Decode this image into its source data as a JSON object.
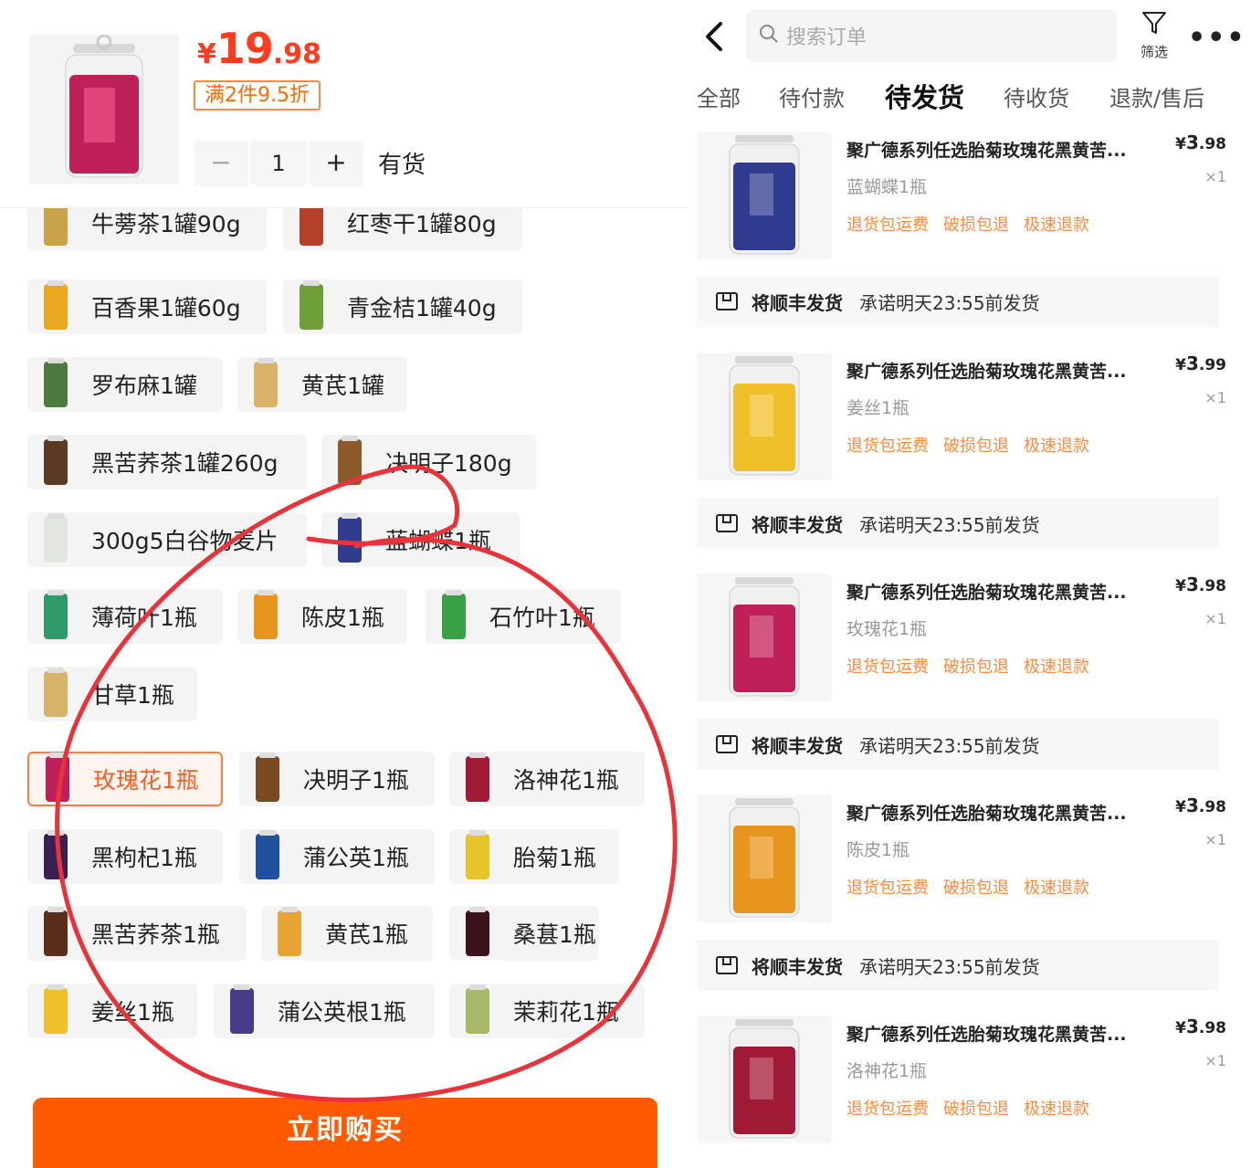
{
  "sku_panel": {
    "price": {
      "currency": "¥",
      "integer": "19",
      "decimal": ".98"
    },
    "promo": "满2件9.5折",
    "quantity": {
      "minus": "−",
      "value": "1",
      "plus": "+"
    },
    "stock": "有货",
    "options": [
      {
        "label": "牛蒡茶1罐90g",
        "color": "#c9a24a"
      },
      {
        "label": "红枣干1罐80g",
        "color": "#b5402a"
      },
      {
        "label": "百香果1罐60g",
        "color": "#e8a821"
      },
      {
        "label": "青金桔1罐40g",
        "color": "#6f9e3a"
      },
      {
        "label": "罗布麻1罐",
        "color": "#4d7a3e"
      },
      {
        "label": "黄芪1罐",
        "color": "#d9b36a"
      },
      {
        "label": "黑苦荞茶1罐260g",
        "color": "#5a3a24"
      },
      {
        "label": "决明子180g",
        "color": "#8a5a2a"
      },
      {
        "label": "300g5白谷物麦片",
        "color": "#e3e6df"
      },
      {
        "label": "蓝蝴蝶1瓶",
        "color": "#2f3c8f"
      },
      {
        "label": "薄荷叶1瓶",
        "color": "#2f9a6a"
      },
      {
        "label": "陈皮1瓶",
        "color": "#e8951d"
      },
      {
        "label": "石竹叶1瓶",
        "color": "#3aa046"
      },
      {
        "label": "甘草1瓶",
        "color": "#d8b46a"
      },
      {
        "label": "玫瑰花1瓶",
        "color": "#c0205a"
      },
      {
        "label": "决明子1瓶",
        "color": "#7a4a24"
      },
      {
        "label": "洛神花1瓶",
        "color": "#a01a36"
      },
      {
        "label": "黑枸杞1瓶",
        "color": "#3a1f52"
      },
      {
        "label": "蒲公英1瓶",
        "color": "#2050a0"
      },
      {
        "label": "胎菊1瓶",
        "color": "#e6c42a"
      },
      {
        "label": "黑苦荞茶1瓶",
        "color": "#5a2e1a"
      },
      {
        "label": "黄芪1瓶",
        "color": "#e8a432"
      },
      {
        "label": "桑葚1瓶",
        "color": "#3a1418"
      },
      {
        "label": "姜丝1瓶",
        "color": "#f0c02a"
      },
      {
        "label": "蒲公英根1瓶",
        "color": "#4a3a8a"
      },
      {
        "label": "茉莉花1瓶",
        "color": "#a8b86a"
      }
    ],
    "selected_option": "玫瑰花1瓶",
    "buy_button": "立即购买",
    "accent_color": "#ff5a00",
    "annotation_color": "#e8333a"
  },
  "orders_panel": {
    "search_placeholder": "搜索订单",
    "filter_label": "筛选",
    "more": "•••",
    "tabs": [
      "全部",
      "待付款",
      "待发货",
      "待收货",
      "退款/售后"
    ],
    "active_tab": "待发货",
    "orders": [
      {
        "title": "聚广德系列任选胎菊玫瑰花黑黄苦...",
        "sku": "蓝蝴蝶1瓶",
        "price_prefix": "¥",
        "price_int": "3",
        "price_dec": ".98",
        "qty": "×1",
        "tags": [
          "退货包运费",
          "破损包退",
          "极速退款"
        ],
        "jar_color": "#2f3c8f"
      },
      {
        "title": "聚广德系列任选胎菊玫瑰花黑黄苦...",
        "sku": "姜丝1瓶",
        "price_prefix": "¥",
        "price_int": "3",
        "price_dec": ".99",
        "qty": "×1",
        "tags": [
          "退货包运费",
          "破损包退",
          "极速退款"
        ],
        "jar_color": "#f0c02a"
      },
      {
        "title": "聚广德系列任选胎菊玫瑰花黑黄苦...",
        "sku": "玫瑰花1瓶",
        "price_prefix": "¥",
        "price_int": "3",
        "price_dec": ".98",
        "qty": "×1",
        "tags": [
          "退货包运费",
          "破损包退",
          "极速退款"
        ],
        "jar_color": "#c0205a"
      },
      {
        "title": "聚广德系列任选胎菊玫瑰花黑黄苦...",
        "sku": "陈皮1瓶",
        "price_prefix": "¥",
        "price_int": "3",
        "price_dec": ".98",
        "qty": "×1",
        "tags": [
          "退货包运费",
          "破损包退",
          "极速退款"
        ],
        "jar_color": "#e8951d"
      },
      {
        "title": "聚广德系列任选胎菊玫瑰花黑黄苦...",
        "sku": "洛神花1瓶",
        "price_prefix": "¥",
        "price_int": "3",
        "price_dec": ".98",
        "qty": "×1",
        "tags": [
          "退货包运费",
          "破损包退",
          "极速退款"
        ],
        "jar_color": "#a01a36"
      }
    ],
    "shipping": {
      "name": "将顺丰发货",
      "promise": "承诺明天23:55前发货"
    }
  }
}
